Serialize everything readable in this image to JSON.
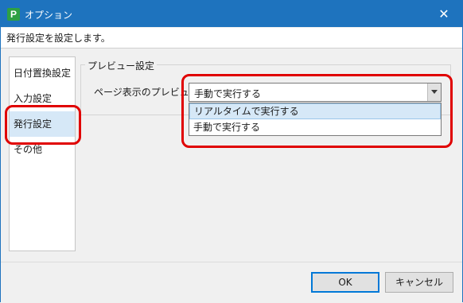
{
  "window": {
    "app_icon_letter": "P",
    "title": "オプション",
    "close_glyph": "✕"
  },
  "description": "発行設定を設定します。",
  "nav": {
    "items": [
      {
        "label": "日付置換設定"
      },
      {
        "label": "入力設定"
      },
      {
        "label": "発行設定",
        "selected": true
      },
      {
        "label": "その他"
      }
    ]
  },
  "preview_group": {
    "title": "プレビュー設定",
    "field_label": "ページ表示のプレビュー：",
    "selected_value": "手動で実行する",
    "options": [
      {
        "label": "リアルタイムで実行する",
        "highlighted": true
      },
      {
        "label": "手動で実行する"
      }
    ]
  },
  "footer": {
    "ok_label": "OK",
    "cancel_label": "キャンセル"
  },
  "colors": {
    "titlebar": "#1e73be",
    "selection": "#d6e8f7",
    "annotation": "#e00000",
    "app_icon": "#2ea043"
  },
  "icons": [
    "app-icon",
    "close-icon",
    "chevron-down-icon"
  ]
}
